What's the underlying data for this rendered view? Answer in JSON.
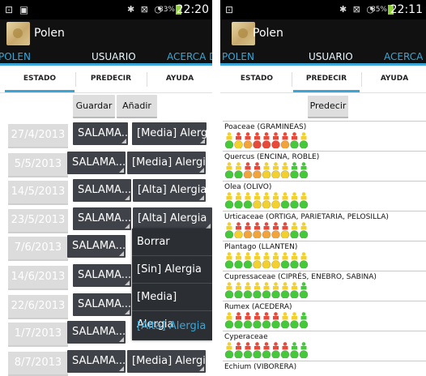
{
  "screen1": {
    "status": {
      "left": "⊡ ▣",
      "icons": "✱ ⊠ ◔",
      "battery": "83%",
      "battery_color": "#8fd13a",
      "time": "22:20"
    },
    "app_title": "Polen",
    "nav_tabs": [
      "POLEN",
      "USUARIO",
      "ACERCA DE"
    ],
    "nav_active": "USUARIO",
    "sub_tabs": [
      "ESTADO",
      "PREDECIR",
      "AYUDA"
    ],
    "sub_active": "ESTADO",
    "buttons": {
      "save": "Guardar",
      "add": "Añadir"
    },
    "rows": [
      {
        "date": "27/4/2013",
        "place": "SALAMA...",
        "level": "[Media] Alergia"
      },
      {
        "date": "5/5/2013",
        "place": "SALAMA...",
        "level": "[Media] Alergia"
      },
      {
        "date": "14/5/2013",
        "place": "SALAMA...",
        "level": "[Alta] Alergia"
      },
      {
        "date": "23/5/2013",
        "place": "SALAMA...",
        "level": "[Alta] Alergia"
      },
      {
        "date": "7/6/2013",
        "place": "SALAMA...",
        "level": ""
      },
      {
        "date": "14/6/2013",
        "place": "SALAMA...",
        "level": ""
      },
      {
        "date": "22/6/2013",
        "place": "SALAMA...",
        "level": ""
      },
      {
        "date": "1/7/2013",
        "place": "SALAMA...",
        "level": ""
      },
      {
        "date": "8/7/2013",
        "place": "SALAMA...",
        "level": "[Media] Alergia"
      }
    ],
    "popup_menu": [
      "Borrar",
      "[Sin] Alergia",
      "[Media] Alergia",
      "[Alta] Alergia"
    ],
    "popup_selected": "[Alta] Alergia"
  },
  "screen2": {
    "status": {
      "left": "⊡",
      "icons": "✱ ⊠ ◔",
      "battery": "85%",
      "battery_color": "#8fd13a",
      "time": "22:11"
    },
    "app_title": "Polen",
    "nav_tabs": [
      "POLEN",
      "USUARIO",
      "ACERCA DE"
    ],
    "nav_active": "USUARIO",
    "sub_tabs": [
      "ESTADO",
      "PREDECIR",
      "AYUDA"
    ],
    "sub_active": "PREDECIR",
    "predict_button": "Predecir",
    "colors": {
      "green": "#45c83a",
      "yellow": "#f2d02e",
      "orange": "#f2a43a",
      "red": "#e84a3a",
      "accent": "#3aa6d8"
    },
    "plants": [
      {
        "name": "Poaceae (GRAMINEAS)",
        "figures": [
          "y",
          "r",
          "r",
          "r",
          "r",
          "r",
          "r",
          "r",
          "y"
        ],
        "circles": [
          "g",
          "y",
          "o",
          "r",
          "r",
          "r",
          "o",
          "g",
          "g"
        ]
      },
      {
        "name": "Quercus (ENCINA, ROBLE)",
        "figures": [
          "y",
          "y",
          "r",
          "r",
          "y",
          "y",
          "y",
          "g",
          "g"
        ],
        "circles": [
          "g",
          "g",
          "o",
          "o",
          "y",
          "y",
          "y",
          "g",
          "g"
        ]
      },
      {
        "name": "Olea (OLIVO)",
        "figures": [
          "y",
          "y",
          "y",
          "y",
          "y",
          "y",
          "y",
          "y",
          "y"
        ],
        "circles": [
          "g",
          "g",
          "g",
          "y",
          "y",
          "y",
          "g",
          "g",
          "g"
        ]
      },
      {
        "name": "Urticaceae (ORTIGA, PARIETARIA, PELOSILLA)",
        "figures": [
          "y",
          "r",
          "r",
          "r",
          "r",
          "r",
          "r",
          "y",
          "y"
        ],
        "circles": [
          "g",
          "y",
          "o",
          "o",
          "o",
          "o",
          "y",
          "g",
          "g"
        ]
      },
      {
        "name": "Plantago (LLANTEN)",
        "figures": [
          "y",
          "y",
          "y",
          "y",
          "y",
          "y",
          "y",
          "y",
          "y"
        ],
        "circles": [
          "g",
          "g",
          "g",
          "y",
          "y",
          "y",
          "g",
          "g",
          "g"
        ]
      },
      {
        "name": "Cupressaceae (CIPRÉS, ENEBRO, SABINA)",
        "figures": [
          "y",
          "y",
          "y",
          "y",
          "y",
          "y",
          "y",
          "y",
          "g"
        ],
        "circles": [
          "g",
          "g",
          "g",
          "g",
          "g",
          "g",
          "g",
          "g",
          "g"
        ]
      },
      {
        "name": "Rumex (ACEDERA)",
        "figures": [
          "y",
          "r",
          "r",
          "r",
          "r",
          "r",
          "y",
          "y",
          "g"
        ],
        "circles": [
          "g",
          "g",
          "g",
          "g",
          "g",
          "g",
          "g",
          "g",
          "g"
        ]
      },
      {
        "name": "Cyperaceae",
        "figures": [
          "y",
          "r",
          "r",
          "r",
          "r",
          "r",
          "r",
          "g",
          "g"
        ],
        "circles": [
          "g",
          "g",
          "g",
          "g",
          "g",
          "g",
          "g",
          "g",
          "g"
        ]
      },
      {
        "name": "Echium (VIBORERA)",
        "figures": [],
        "circles": []
      }
    ]
  }
}
